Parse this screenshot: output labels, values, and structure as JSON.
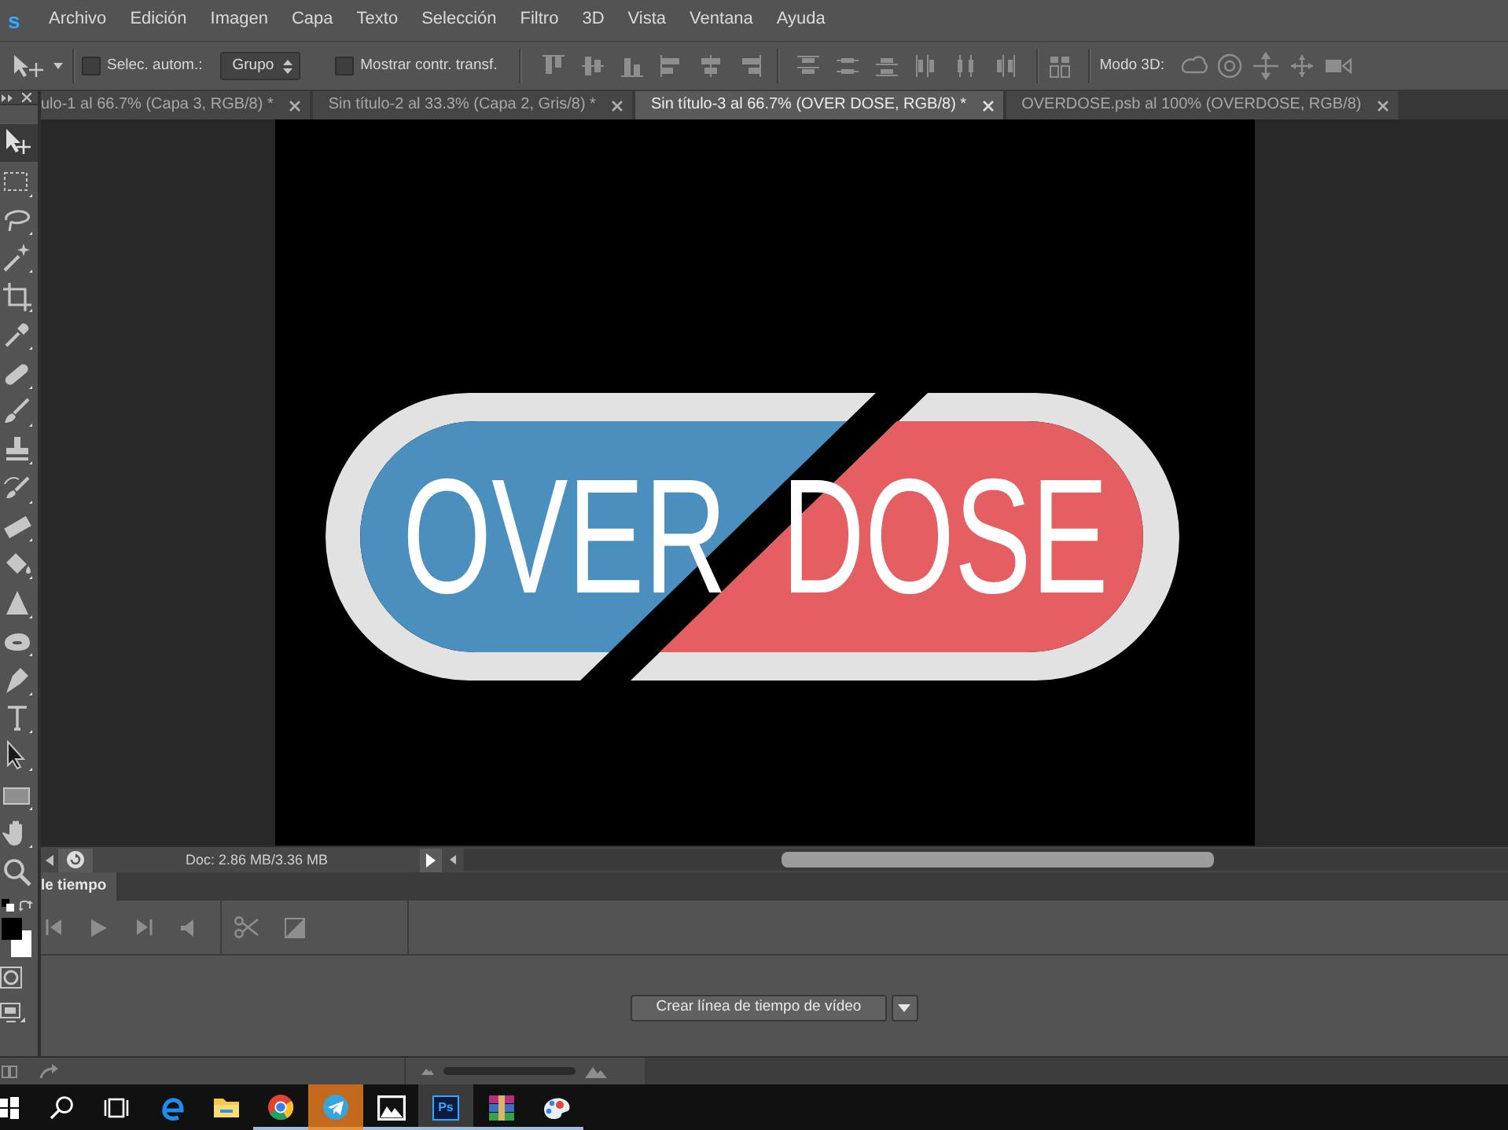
{
  "menu_bar": {
    "logo": "s",
    "items": [
      "Archivo",
      "Edición",
      "Imagen",
      "Capa",
      "Texto",
      "Selección",
      "Filtro",
      "3D",
      "Vista",
      "Ventana",
      "Ayuda"
    ]
  },
  "options_bar": {
    "auto_select": {
      "label": "Selec. autom.:",
      "checked": false
    },
    "auto_select_target": {
      "value": "Grupo"
    },
    "show_transform": {
      "label": "Mostrar contr. transf.",
      "checked": false
    },
    "mode_3d_label": "Modo 3D:"
  },
  "tools": [
    {
      "kind": "move",
      "selected": true
    },
    {
      "kind": "marquee",
      "selected": false
    },
    {
      "kind": "lasso",
      "selected": false
    },
    {
      "kind": "wand",
      "selected": false
    },
    {
      "kind": "crop",
      "selected": false
    },
    {
      "kind": "eyedropper",
      "selected": false
    },
    {
      "kind": "healing",
      "selected": false
    },
    {
      "kind": "brush",
      "selected": false
    },
    {
      "kind": "stamp",
      "selected": false
    },
    {
      "kind": "history",
      "selected": false
    },
    {
      "kind": "eraser",
      "selected": false
    },
    {
      "kind": "bucket",
      "selected": false
    },
    {
      "kind": "sharpen",
      "selected": false
    },
    {
      "kind": "sponge",
      "selected": false
    },
    {
      "kind": "pen",
      "selected": false
    },
    {
      "kind": "type",
      "selected": false
    },
    {
      "kind": "path_select",
      "selected": false
    },
    {
      "kind": "rectangle",
      "selected": false
    },
    {
      "kind": "hand",
      "selected": false
    },
    {
      "kind": "zoom",
      "selected": false
    }
  ],
  "color_swatches": [
    {
      "kind": "foreground",
      "color": "#000000"
    },
    {
      "kind": "background",
      "color": "#ffffff"
    }
  ],
  "document_tabs": [
    {
      "label": "ulo-1 al 66.7% (Capa 3, RGB/8) *",
      "selected": false
    },
    {
      "label": "Sin título-2 al 33.3% (Capa 2, Gris/8) *",
      "selected": false
    },
    {
      "label": "Sin título-3 al 66.7% (OVER DOSE, RGB/8) *",
      "selected": true
    },
    {
      "label": "OVERDOSE.psb al 100% (OVERDOSE, RGB/8)",
      "selected": false
    }
  ],
  "canvas": {
    "logo": {
      "left_word": "OVER",
      "right_word": "DOSE"
    }
  },
  "status_bar": {
    "doc_info": "Doc: 2.86 MB/3.36 MB"
  },
  "timeline": {
    "tab_label": "le tiempo",
    "create_button": "Crear línea de tiempo de vídeo"
  },
  "taskbar": {
    "items": [
      {
        "kind": "start",
        "running": false,
        "active": false,
        "flashing": false
      },
      {
        "kind": "search",
        "running": false,
        "active": false,
        "flashing": false
      },
      {
        "kind": "task_view",
        "running": false,
        "active": false,
        "flashing": false
      },
      {
        "kind": "edge",
        "running": false,
        "active": false,
        "flashing": false
      },
      {
        "kind": "folder",
        "running": false,
        "active": false,
        "flashing": false
      },
      {
        "kind": "chrome",
        "running": true,
        "active": false,
        "flashing": false
      },
      {
        "kind": "telegram",
        "running": true,
        "active": false,
        "flashing": true
      },
      {
        "kind": "photos",
        "running": true,
        "active": false,
        "flashing": false
      },
      {
        "kind": "tile",
        "label": "Ps",
        "running": true,
        "active": true,
        "flashing": false
      },
      {
        "kind": "archive",
        "running": true,
        "active": false,
        "flashing": false
      },
      {
        "kind": "paint",
        "running": true,
        "active": false,
        "flashing": false
      }
    ]
  }
}
